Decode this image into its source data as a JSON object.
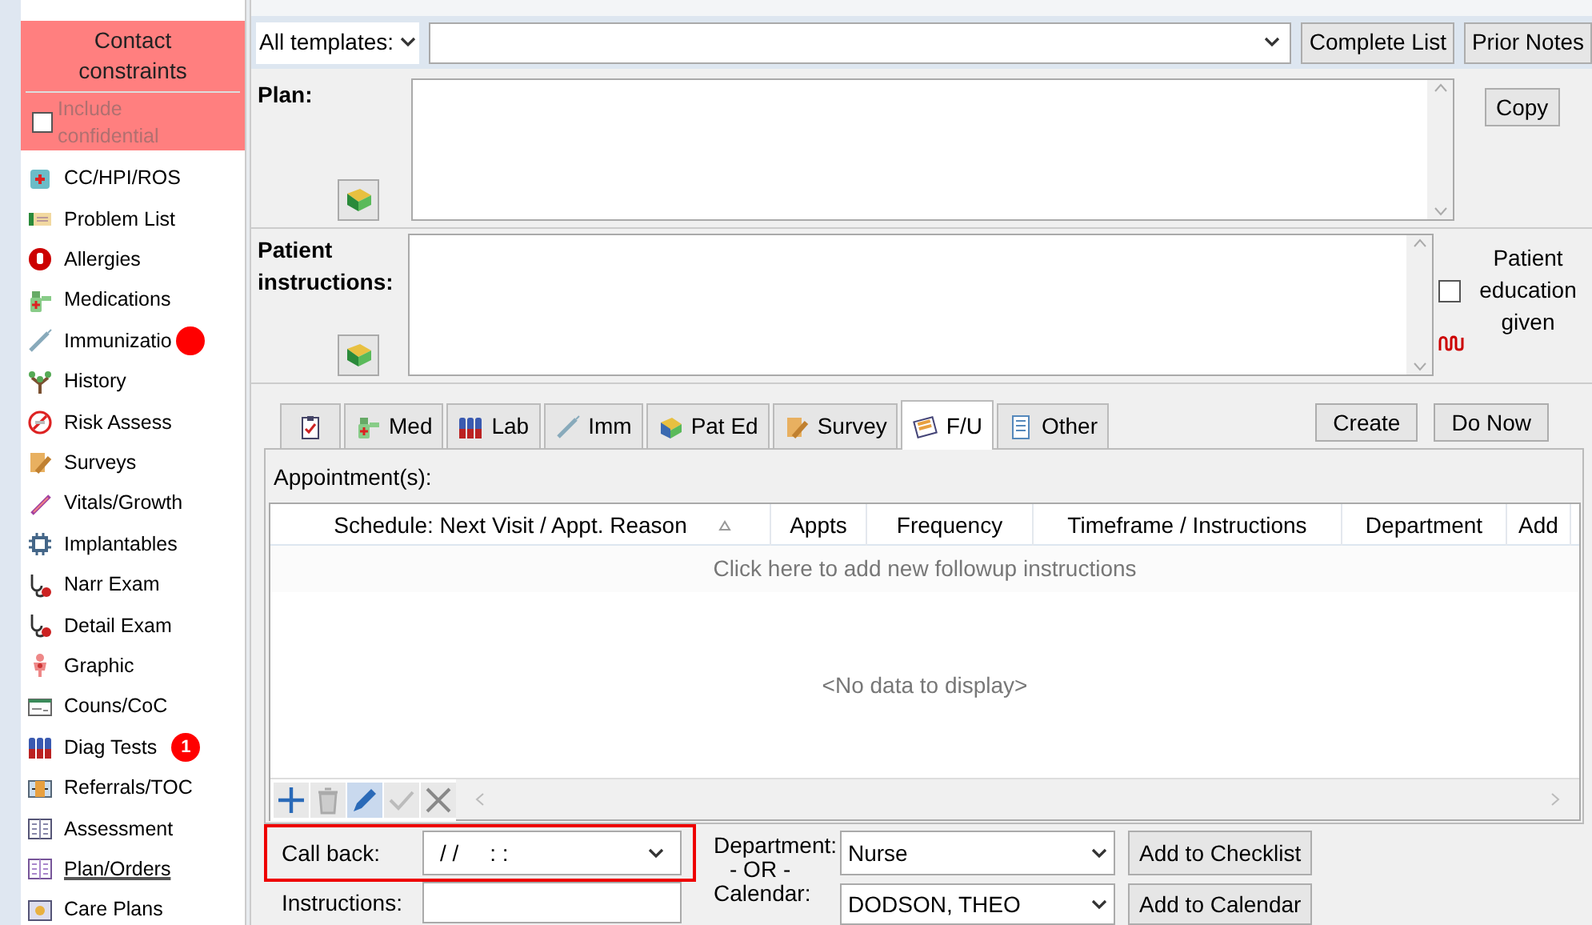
{
  "sidebar": {
    "header": "Contact constraints",
    "include_confidential": {
      "label": "Include confidential",
      "checked": false
    },
    "items": [
      {
        "label": "CC/HPI/ROS",
        "selected": false
      },
      {
        "label": "Problem List",
        "selected": false
      },
      {
        "label": "Allergies",
        "selected": false
      },
      {
        "label": "Medications",
        "selected": false
      },
      {
        "label": "Immunizatio",
        "selected": false,
        "badge": {
          "kind": "dot"
        }
      },
      {
        "label": "History",
        "selected": false
      },
      {
        "label": "Risk Assess",
        "selected": false
      },
      {
        "label": "Surveys",
        "selected": false
      },
      {
        "label": "Vitals/Growth",
        "selected": false
      },
      {
        "label": "Implantables",
        "selected": false
      },
      {
        "label": "Narr Exam",
        "selected": false
      },
      {
        "label": "Detail Exam",
        "selected": false
      },
      {
        "label": "Graphic",
        "selected": false
      },
      {
        "label": "Couns/CoC",
        "selected": false
      },
      {
        "label": "Diag Tests",
        "selected": false,
        "badge": {
          "kind": "count",
          "text": "1"
        }
      },
      {
        "label": "Referrals/TOC",
        "selected": false
      },
      {
        "label": "Assessment",
        "selected": false
      },
      {
        "label": "Plan/Orders",
        "selected": true
      },
      {
        "label": "Care Plans",
        "selected": false
      }
    ]
  },
  "toolbar": {
    "templates": "All templates:",
    "buttons": [
      "Complete List",
      "Prior Notes"
    ]
  },
  "plan": {
    "label": "Plan:",
    "button": "Copy"
  },
  "patient_instructions": {
    "label": "Patient instructions:",
    "education": {
      "label": "Patient education given",
      "checked": false
    }
  },
  "tabs": [
    {
      "kind": "icon",
      "selected": false
    },
    {
      "kind": "text",
      "label": "Med",
      "selected": false
    },
    {
      "kind": "text",
      "label": "Lab",
      "selected": false
    },
    {
      "kind": "text",
      "label": "Imm",
      "selected": false
    },
    {
      "kind": "text",
      "label": "Pat Ed",
      "selected": false
    },
    {
      "kind": "text",
      "label": "Survey",
      "selected": false
    },
    {
      "kind": "text",
      "label": "F/U",
      "selected": true
    },
    {
      "kind": "text",
      "label": "Other",
      "selected": false
    }
  ],
  "tab_buttons": [
    "Create",
    "Do Now"
  ],
  "appointments": {
    "label": "Appointment(s):",
    "columns": [
      {
        "label": "Schedule: Next Visit / Appt. Reason",
        "sorted": true
      },
      {
        "label": "Appts",
        "sorted": false
      },
      {
        "label": "Frequency",
        "sorted": false
      },
      {
        "label": "Timeframe / Instructions",
        "sorted": false
      },
      {
        "label": "Department",
        "sorted": false
      },
      {
        "label": "Add",
        "sorted": false
      }
    ],
    "new_row": "Click here to add new followup instructions",
    "empty": "<No data to display>"
  },
  "followup": {
    "call_back": {
      "label": "Call back:",
      "value": "/ /     : :"
    },
    "instructions": {
      "label": "Instructions:"
    },
    "department": {
      "label": "Department:",
      "value": "Nurse"
    },
    "or": "- OR -",
    "calendar": {
      "label": "Calendar:",
      "value": "DODSON, THEO"
    },
    "buttons": [
      "Add to Checklist",
      "Add to Calendar"
    ]
  }
}
